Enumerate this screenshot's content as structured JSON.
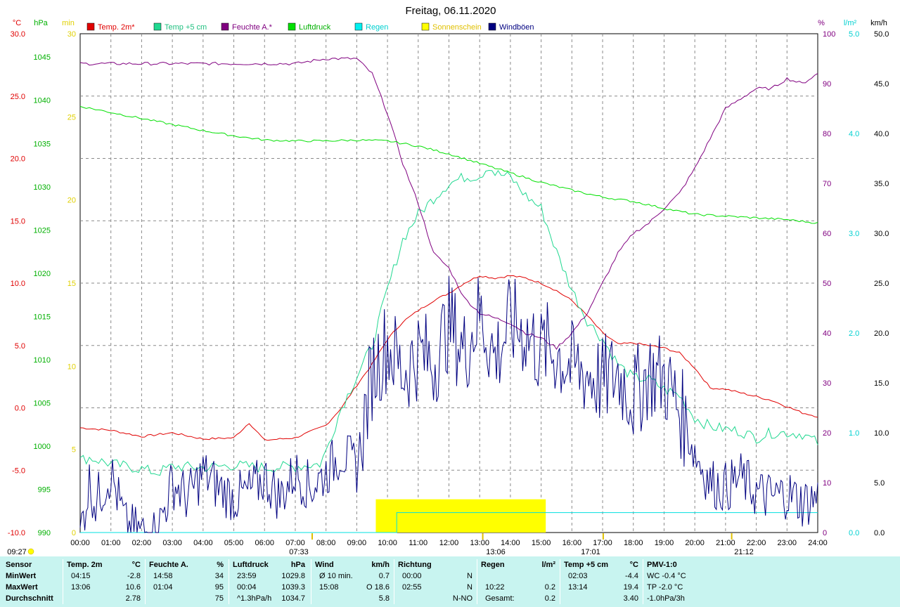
{
  "chart_data": {
    "type": "line",
    "title": "Freitag, 06.11.2020",
    "x_ticks": [
      "00:00",
      "01:00",
      "02:00",
      "03:00",
      "04:00",
      "05:00",
      "06:00",
      "07:00",
      "08:00",
      "09:00",
      "10:00",
      "11:00",
      "12:00",
      "13:00",
      "14:00",
      "15:00",
      "16:00",
      "17:00",
      "18:00",
      "19:00",
      "20:00",
      "21:00",
      "22:00",
      "23:00",
      "24:00"
    ],
    "axes": {
      "temp": {
        "unit": "°C",
        "min": -10,
        "max": 30,
        "ticks": [
          "30.0",
          "25.0",
          "20.0",
          "15.0",
          "10.0",
          "5.0",
          "0.0",
          "-5.0",
          "-10.0"
        ],
        "color": "#ff0000"
      },
      "pressure": {
        "unit": "hPa",
        "min": 990,
        "max": 1047.7,
        "ticks": [
          "1045",
          "1040",
          "1035",
          "1030",
          "1025",
          "1020",
          "1015",
          "1010",
          "1005",
          "1000",
          "995",
          "990"
        ],
        "color": "#00c000"
      },
      "sunshine": {
        "unit": "min",
        "min": 0,
        "max": 30,
        "ticks": [
          "30",
          "25",
          "20",
          "15",
          "10",
          "5",
          "0"
        ],
        "color": "#e0e000"
      },
      "humidity": {
        "unit": "%",
        "min": 0,
        "max": 100,
        "ticks": [
          "100",
          "90",
          "80",
          "70",
          "60",
          "50",
          "40",
          "30",
          "20",
          "10",
          "0"
        ],
        "color": "#800080"
      },
      "rain": {
        "unit": "l/m²",
        "min": 0,
        "max": 5,
        "ticks": [
          "5.0",
          "4.0",
          "3.0",
          "2.0",
          "1.0",
          "0.0"
        ],
        "color": "#00e0e0"
      },
      "wind": {
        "unit": "km/h",
        "min": 0,
        "max": 50,
        "ticks": [
          "50.0",
          "45.0",
          "40.0",
          "35.0",
          "30.0",
          "25.0",
          "20.0",
          "15.0",
          "10.0",
          "5.0",
          "0.0"
        ],
        "color": "#000000"
      }
    },
    "legend": [
      {
        "name": "Temp. 2m*",
        "color": "#e00000"
      },
      {
        "name": "Temp +5 cm",
        "color": "#20d890"
      },
      {
        "name": "Feuchte A.*",
        "color": "#800080"
      },
      {
        "name": "Luftdruck",
        "color": "#00e000"
      },
      {
        "name": "Regen",
        "color": "#00f0f0"
      },
      {
        "name": "Sonnenschein",
        "color": "#ffff00"
      },
      {
        "name": "Windböen",
        "color": "#000080"
      }
    ],
    "series": [
      {
        "name": "Temp. 2m*",
        "axis": "temp",
        "color": "#e00000",
        "x": [
          0,
          1,
          2,
          3,
          4,
          5,
          5.5,
          6,
          7,
          8,
          8.5,
          9,
          9.5,
          10,
          10.5,
          11,
          11.5,
          12,
          12.5,
          13,
          13.5,
          14,
          14.5,
          15,
          15.5,
          16,
          16.5,
          17,
          17.5,
          18,
          19,
          19.5,
          20,
          20.5,
          21,
          21.5,
          22,
          22.5,
          23,
          23.5,
          24
        ],
        "y": [
          -1.6,
          -1.8,
          -2.3,
          -2.0,
          -2.5,
          -2.4,
          -1.2,
          -2.6,
          -2.4,
          -1.4,
          0.0,
          1.8,
          3.5,
          5.5,
          6.9,
          7.8,
          8.6,
          9.2,
          10.0,
          10.6,
          10.4,
          10.6,
          10.4,
          10.0,
          9.4,
          8.6,
          7.4,
          6.0,
          5.1,
          5.2,
          4.8,
          4.4,
          3.2,
          1.6,
          1.5,
          1.2,
          0.9,
          0.6,
          0.1,
          -0.4,
          -0.7
        ]
      },
      {
        "name": "Temp +5 cm",
        "axis": "temp",
        "color": "#20d890",
        "x": [
          0,
          0.3,
          1,
          2,
          2.5,
          3,
          4,
          5,
          6,
          7,
          7.8,
          8,
          8.5,
          9,
          9.5,
          10,
          10.5,
          11,
          11.5,
          12,
          12.5,
          13,
          13.3,
          13.5,
          14,
          14.5,
          15,
          15.5,
          16,
          16.5,
          17,
          17.5,
          18,
          18.5,
          19,
          19.5,
          20,
          20.5,
          21,
          21.5,
          22,
          22.5,
          23,
          23.5,
          24
        ],
        "y": [
          -4.2,
          -4.0,
          -4.5,
          -4.9,
          -5.2,
          -4.7,
          -4.8,
          -4.6,
          -4.8,
          -4.7,
          -4.5,
          -3.5,
          0.0,
          2.5,
          5.0,
          9.5,
          13.5,
          15.5,
          16.8,
          18.0,
          18.5,
          18.6,
          19.4,
          18.8,
          18.5,
          17.0,
          16.0,
          12.5,
          9.5,
          7.0,
          5.5,
          3.5,
          2.4,
          2.3,
          1.5,
          1.0,
          -0.8,
          -1.5,
          -1.7,
          -1.9,
          -2.4,
          -2.0,
          -2.0,
          -2.1,
          -2.8
        ]
      },
      {
        "name": "Feuchte A.*",
        "axis": "humidity",
        "color": "#800080",
        "x": [
          0,
          1,
          2,
          3,
          4,
          5,
          6,
          7,
          8,
          9,
          9.5,
          10,
          10.5,
          11,
          11.5,
          12,
          12.5,
          13,
          13.5,
          14,
          14.5,
          15,
          15.5,
          16,
          16.5,
          17,
          17.5,
          18,
          18.5,
          19,
          19.5,
          20,
          20.5,
          21,
          21.5,
          22,
          22.5,
          23,
          23.5,
          24
        ],
        "y": [
          94,
          94,
          94,
          94,
          94,
          94,
          94,
          94,
          95,
          95,
          92,
          84,
          74,
          66,
          56,
          53,
          47,
          44,
          43,
          42,
          40,
          39,
          37,
          40,
          44,
          50,
          56,
          60,
          62,
          65,
          68,
          73,
          79,
          85,
          87,
          89,
          89,
          91,
          90,
          92
        ]
      },
      {
        "name": "Luftdruck",
        "axis": "pressure",
        "color": "#00e000",
        "x": [
          0,
          1,
          2,
          3,
          4,
          5,
          6,
          7,
          8,
          9,
          10,
          11,
          12,
          13,
          14,
          15,
          16,
          17,
          18,
          19,
          20,
          21,
          22,
          23,
          24
        ],
        "y": [
          1039.3,
          1038.6,
          1037.9,
          1037.2,
          1036.5,
          1035.9,
          1035.4,
          1035.3,
          1035.3,
          1035.4,
          1035.3,
          1034.7,
          1033.8,
          1032.7,
          1031.6,
          1030.5,
          1029.6,
          1028.8,
          1028.3,
          1027.5,
          1026.8,
          1026.6,
          1026.4,
          1026.2,
          1025.8
        ]
      },
      {
        "name": "Regen",
        "axis": "rain",
        "color": "#00e0e0",
        "x": [
          0,
          10.3,
          10.3,
          24
        ],
        "y": [
          0,
          0,
          0.2,
          0.2
        ]
      },
      {
        "name": "Windböen",
        "axis": "wind",
        "color": "#000080",
        "x": [
          0,
          0.3,
          0.5,
          1,
          1.5,
          2,
          2.5,
          3,
          3.5,
          4,
          4.5,
          5,
          5.5,
          6,
          6.5,
          7,
          7.5,
          8,
          8.5,
          9,
          9.5,
          10,
          10.5,
          11,
          11.5,
          12,
          12.5,
          13,
          13.5,
          14,
          14.5,
          15,
          15.1,
          15.5,
          16,
          16.5,
          17,
          17.5,
          18,
          18.5,
          19,
          19.5,
          20,
          20.5,
          21,
          21.5,
          22,
          22.5,
          23,
          23.5,
          24
        ],
        "y": [
          0,
          5.0,
          3.0,
          6.0,
          0.5,
          0.0,
          0.0,
          5.0,
          3.5,
          6.0,
          4.5,
          3.5,
          4.0,
          5.5,
          3.5,
          6.0,
          4.5,
          6.0,
          8.0,
          6.5,
          16.0,
          19.0,
          16.0,
          18.0,
          17.0,
          21.0,
          18.0,
          22.0,
          17.5,
          21.0,
          20.0,
          18.0,
          18.6,
          18.0,
          16.5,
          16.0,
          15.0,
          16.0,
          13.5,
          16.0,
          15.5,
          12.5,
          8.0,
          5.0,
          4.5,
          5.5,
          4.0,
          3.5,
          4.0,
          3.0,
          3.5
        ]
      }
    ],
    "sunshine_bar": {
      "from": 9.62,
      "to": 15.15,
      "minutes": 2
    },
    "marker_labels": [
      {
        "label": "09:27",
        "type": "sunrise"
      },
      {
        "label": "07:33",
        "type": "dawn"
      },
      {
        "label": "13:06",
        "type": "noon"
      },
      {
        "label": "17:01",
        "type": "sunset"
      },
      {
        "label": "21:12",
        "type": "moon"
      }
    ],
    "grid": true
  },
  "stats": {
    "columns": [
      {
        "header": "Sensor",
        "unit": "",
        "rows": [
          [
            "MinWert"
          ],
          [
            "MaxWert"
          ],
          [
            "Durchschnitt"
          ]
        ]
      },
      {
        "header": "Temp. 2m",
        "unit": "°C",
        "rows": [
          [
            "04:15",
            "-2.8"
          ],
          [
            "13:06",
            "10.6"
          ],
          [
            "",
            "2.78"
          ]
        ]
      },
      {
        "header": "Feuchte A.",
        "unit": "%",
        "rows": [
          [
            "14:58",
            "34"
          ],
          [
            "01:04",
            "95"
          ],
          [
            "",
            "75"
          ]
        ]
      },
      {
        "header": "Luftdruck",
        "unit": "hPa",
        "rows": [
          [
            "23:59",
            "1029.8"
          ],
          [
            "00:04",
            "1039.3"
          ],
          [
            "^1.3hPa/h",
            "1034.7"
          ]
        ]
      },
      {
        "header": "Wind",
        "unit": "km/h",
        "rows": [
          [
            "Ø 10 min.",
            "0.7"
          ],
          [
            "15:08",
            "O 18.6"
          ],
          [
            "",
            "5.8"
          ]
        ]
      },
      {
        "header": "Richtung",
        "unit": "",
        "rows": [
          [
            "00:00",
            "N"
          ],
          [
            "02:55",
            "N"
          ],
          [
            "",
            "N-NO"
          ]
        ]
      },
      {
        "header": "Regen",
        "unit": "l/m²",
        "rows": [
          [
            "",
            "",
            ""
          ],
          [
            "10:22",
            "0.2"
          ],
          [
            "Gesamt:",
            "0.2"
          ]
        ]
      },
      {
        "header": "Temp +5 cm",
        "unit": "°C",
        "rows": [
          [
            "02:03",
            "-4.4"
          ],
          [
            "13:14",
            "19.4"
          ],
          [
            "",
            "3.40"
          ]
        ]
      },
      {
        "header": "PMV-1:0",
        "unit": "",
        "rows": [
          [
            "WC -0.4 °C"
          ],
          [
            "TP -2.0 °C"
          ],
          [
            "-1.0hPa/3h"
          ]
        ]
      }
    ]
  }
}
